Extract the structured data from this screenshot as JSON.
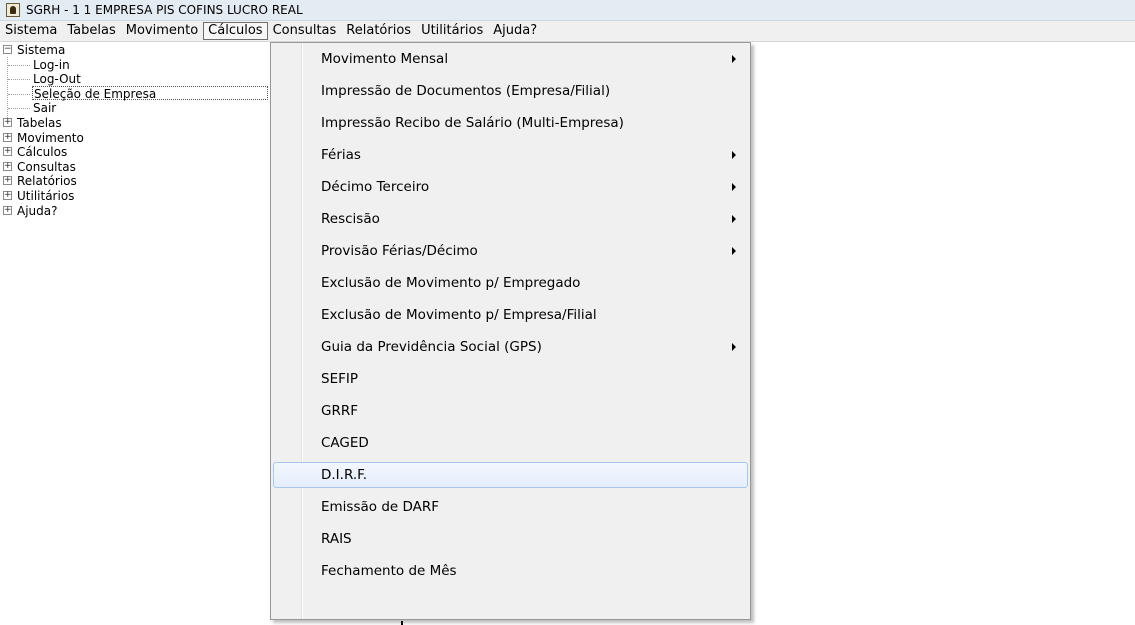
{
  "window": {
    "title": "SGRH - 1 1 EMPRESA PIS COFINS LUCRO REAL"
  },
  "menubar": {
    "items": [
      "Sistema",
      "Tabelas",
      "Movimento",
      "Cálculos",
      "Consultas",
      "Relatórios",
      "Utilitários",
      "Ajuda?"
    ],
    "open_item": "Cálculos"
  },
  "tree": {
    "sistema": {
      "label": "Sistema",
      "expander": "−",
      "children": [
        "Log-in",
        "Log-Out",
        "Seleção de Empresa",
        "Sair"
      ],
      "selected": "Seleção de Empresa"
    },
    "collapsed": [
      "Tabelas",
      "Movimento",
      "Cálculos",
      "Consultas",
      "Relatórios",
      "Utilitários",
      "Ajuda?"
    ],
    "collapsed_expander": "+"
  },
  "calculos_menu": {
    "items": [
      {
        "label": "Movimento Mensal",
        "submenu": true
      },
      {
        "label": "Impressão de Documentos (Empresa/Filial)",
        "submenu": false
      },
      {
        "label": "Impressão Recibo de Salário (Multi-Empresa)",
        "submenu": false
      },
      {
        "label": "Férias",
        "submenu": true
      },
      {
        "label": "Décimo Terceiro",
        "submenu": true
      },
      {
        "label": "Rescisão",
        "submenu": true
      },
      {
        "label": "Provisão Férias/Décimo",
        "submenu": true
      },
      {
        "label": "Exclusão de Movimento p/ Empregado",
        "submenu": false
      },
      {
        "label": "Exclusão de Movimento p/ Empresa/Filial",
        "submenu": false
      },
      {
        "label": "Guia da Previdência Social (GPS)",
        "submenu": true
      },
      {
        "label": "SEFIP",
        "submenu": false
      },
      {
        "label": "GRRF",
        "submenu": false
      },
      {
        "label": "CAGED",
        "submenu": false
      },
      {
        "label": "D.I.R.F.",
        "submenu": false,
        "highlighted": true
      },
      {
        "label": "Emissão de DARF",
        "submenu": false
      },
      {
        "label": "RAIS",
        "submenu": false
      },
      {
        "label": "Fechamento de Mês",
        "submenu": false
      }
    ]
  },
  "colors": {
    "titlebar": "#e3ebf3",
    "menubar": "#f0f0f0",
    "highlight_border": "#a8c7ee",
    "highlight_fill": "#e4eefb"
  }
}
